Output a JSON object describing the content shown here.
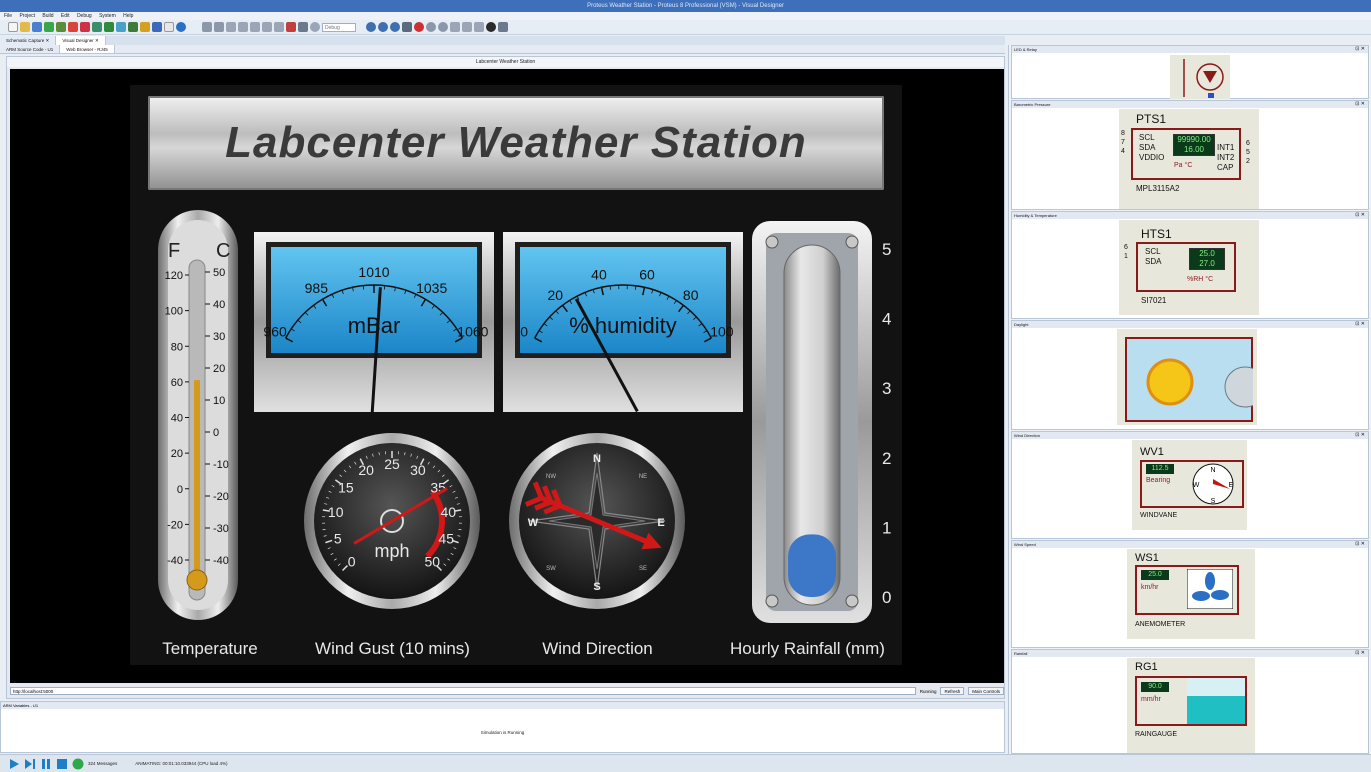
{
  "window": {
    "title": "Proteus Weather Station - Proteus 8 Professional (VSM) - Visual Designer"
  },
  "menu": [
    "File",
    "Project",
    "Build",
    "Edit",
    "Debug",
    "System",
    "Help"
  ],
  "toolbar": {
    "zoom_value": "Debug"
  },
  "tabs_row1": [
    {
      "label": "Schematic Capture"
    },
    {
      "label": "Visual Designer"
    }
  ],
  "tabs_row2": [
    {
      "label": "ARM Source Code - U1"
    },
    {
      "label": "Web Browser - RJ45"
    }
  ],
  "browser": {
    "title": "Labcenter Weather Station",
    "url": "http://localhost:5000",
    "status": "Running",
    "refresh_label": "Refresh",
    "controls_label": "Main Controls"
  },
  "dashboard": {
    "title": "Labcenter Weather Station",
    "thermometer": {
      "label": "Temperature",
      "unit_f": "F",
      "unit_c": "C",
      "fahrenheit_ticks": [
        "120",
        "100",
        "80",
        "60",
        "40",
        "20",
        "0",
        "-20",
        "-40"
      ],
      "celsius_ticks": [
        "50",
        "40",
        "30",
        "20",
        "10",
        "0",
        "-10",
        "-20",
        "-30",
        "-40"
      ],
      "level_f": 61
    },
    "barometer": {
      "unit": "mBar",
      "ticks": [
        "960",
        "985",
        "1010",
        "1035",
        "1060"
      ],
      "value": 1013
    },
    "humidity": {
      "unit": "% humidity",
      "ticks": [
        "0",
        "20",
        "40",
        "60",
        "80",
        "100"
      ],
      "value": 27
    },
    "wind_gust": {
      "label": "Wind Gust (10 mins)",
      "unit": "mph",
      "ticks": [
        "0",
        "5",
        "10",
        "15",
        "20",
        "25",
        "30",
        "35",
        "40",
        "45",
        "50"
      ],
      "value": 36
    },
    "wind_direction": {
      "label": "Wind Direction",
      "cardinals": [
        "N",
        "E",
        "S",
        "W"
      ],
      "intercardinals": [
        "NE",
        "SE",
        "SW",
        "NW"
      ],
      "bearing_deg": 112.5
    },
    "rainfall": {
      "label": "Hourly Rainfall (mm)",
      "ticks": [
        "5",
        "4",
        "3",
        "2",
        "1",
        "0"
      ],
      "value": 0.9
    }
  },
  "right_panels": [
    {
      "title": "LED & Relay"
    },
    {
      "title": "Barometric Pressure",
      "part": "PTS1",
      "pins_left": [
        "SCL",
        "SDA",
        "VDDIO"
      ],
      "pins_right": [
        "INT1",
        "INT2",
        "CAP"
      ],
      "pin_nums_left": [
        "8",
        "7",
        "4"
      ],
      "pin_nums_right": [
        "6",
        "5",
        "2"
      ],
      "display1": "99990.00",
      "display2": "16.00",
      "model": "MPL3115A2",
      "units": [
        "Pa",
        "°C"
      ]
    },
    {
      "title": "Humidity & Temperature",
      "part": "HTS1",
      "pins_left": [
        "SCL",
        "SDA"
      ],
      "pin_nums_left": [
        "6",
        "1"
      ],
      "display1": "25.0",
      "display2": "27.0",
      "model": "SI7021",
      "units": [
        "%RH",
        "°C"
      ]
    },
    {
      "title": "Daylight"
    },
    {
      "title": "Wind Direction",
      "part": "WV1",
      "display": "112.5",
      "unit": "Bearing",
      "model": "WINDVANE",
      "compass": [
        "N",
        "E",
        "S",
        "W"
      ]
    },
    {
      "title": "Wind Speed",
      "part": "WS1",
      "display": "25.0",
      "unit": "km/hr",
      "model": "ANEMOMETER"
    },
    {
      "title": "Rainfall",
      "part": "RG1",
      "display": "90.0",
      "unit": "mm/hr",
      "model": "RAINGAUGE"
    }
  ],
  "sim_panel": {
    "title": "ARM Variables - U1",
    "message": "Simulation is Running"
  },
  "status": {
    "messages": "324 Messages",
    "sim_info": "ANIMATING: 00:01:10.033944 (CPU load 4%)"
  },
  "colors": {
    "panel_bg": "#121212",
    "gauge_blue": "#2aa2e0",
    "needle": "#111111",
    "red": "#d01818",
    "mercury": "#d49a1c",
    "rain": "#3d78c8"
  }
}
